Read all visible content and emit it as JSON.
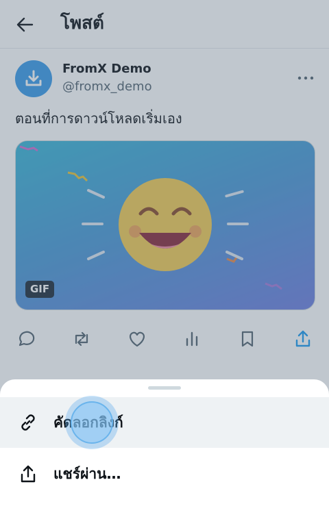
{
  "header": {
    "title": "โพสต์",
    "back_icon": "arrow-left-icon"
  },
  "post": {
    "author_name": "FromX Demo",
    "author_handle": "@fromx_demo",
    "avatar_icon": "download-icon",
    "text": "ตอนที่การดาวน์โหลดเริ่มเอง",
    "media_badge": "GIF"
  },
  "actions": [
    "reply-icon",
    "repost-icon",
    "like-icon",
    "views-icon",
    "bookmark-icon",
    "share-icon"
  ],
  "share_sheet": {
    "items": [
      {
        "label": "คัดลอกลิงก์",
        "icon": "link-icon"
      },
      {
        "label": "แชร์ผ่าน…",
        "icon": "share-icon"
      }
    ]
  },
  "colors": {
    "accent": "#1d9bf0",
    "overlay": "rgba(80,100,120,0.36)"
  }
}
